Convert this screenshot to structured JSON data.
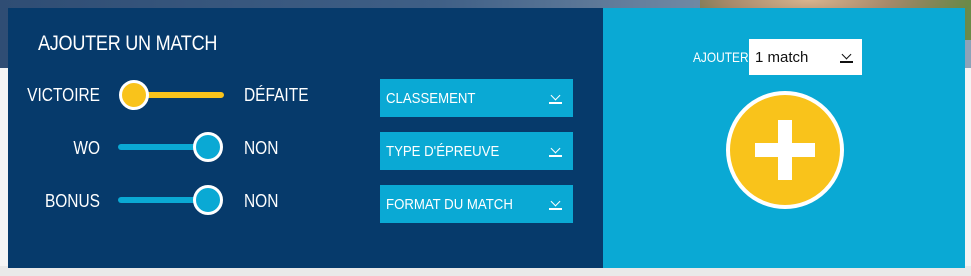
{
  "form": {
    "title": "AJOUTER UN MATCH",
    "rows": [
      {
        "left": "VICTOIRE",
        "right": "DÉFAITE"
      },
      {
        "left": "WO",
        "right": "NON"
      },
      {
        "left": "BONUS",
        "right": "NON"
      }
    ],
    "selects": [
      {
        "label": "CLASSEMENT"
      },
      {
        "label": "TYPE D'ÉPREUVE"
      },
      {
        "label": "FORMAT DU MATCH"
      }
    ]
  },
  "add_panel": {
    "ajouter_label": "AJOUTER",
    "quantity_value": "1 match"
  },
  "colors": {
    "panel_dark": "#063a6b",
    "panel_light": "#0aa9d4",
    "accent_yellow": "#f9c31b",
    "toggle_blue": "#0aa9d4"
  },
  "icons": {
    "dropdown": "chevron-down-icon",
    "add": "plus-icon"
  }
}
